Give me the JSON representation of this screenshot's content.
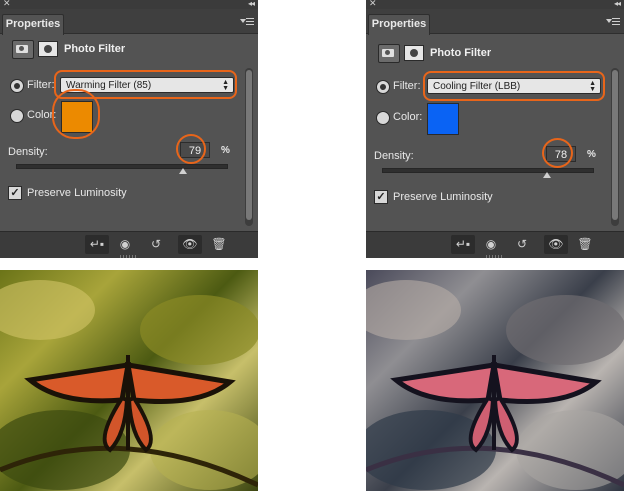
{
  "panels": [
    {
      "tab_label": "Properties",
      "panel_title": "Photo Filter",
      "filter_label": "Filter:",
      "filter_value": "Warming Filter (85)",
      "color_label": "Color:",
      "color_hex": "#ec8a00",
      "density_label": "Density:",
      "density_value": "79",
      "density_fraction": 0.79,
      "percent_sign": "%",
      "preserve_label": "Preserve Luminosity",
      "preserve_checked": true,
      "filter_radio_selected": true
    },
    {
      "tab_label": "Properties",
      "panel_title": "Photo Filter",
      "filter_label": "Filter:",
      "filter_value": "Cooling Filter (LBB)",
      "color_label": "Color:",
      "color_hex": "#0a63f4",
      "density_label": "Density:",
      "density_value": "78",
      "density_fraction": 0.78,
      "percent_sign": "%",
      "preserve_label": "Preserve Luminosity",
      "preserve_checked": true,
      "filter_radio_selected": true
    }
  ],
  "photos": [
    {
      "subject": "butterfly-warm",
      "tone": "warm"
    },
    {
      "subject": "butterfly-cool",
      "tone": "cool"
    }
  ],
  "icons": [
    "close-icon",
    "collapse-icon",
    "panel-menu-icon",
    "adjustment-icon",
    "mask-icon",
    "clip-to-layer-icon",
    "view-previous-icon",
    "reset-icon",
    "visibility-icon",
    "delete-icon"
  ],
  "highlight_color": "#e8651a"
}
